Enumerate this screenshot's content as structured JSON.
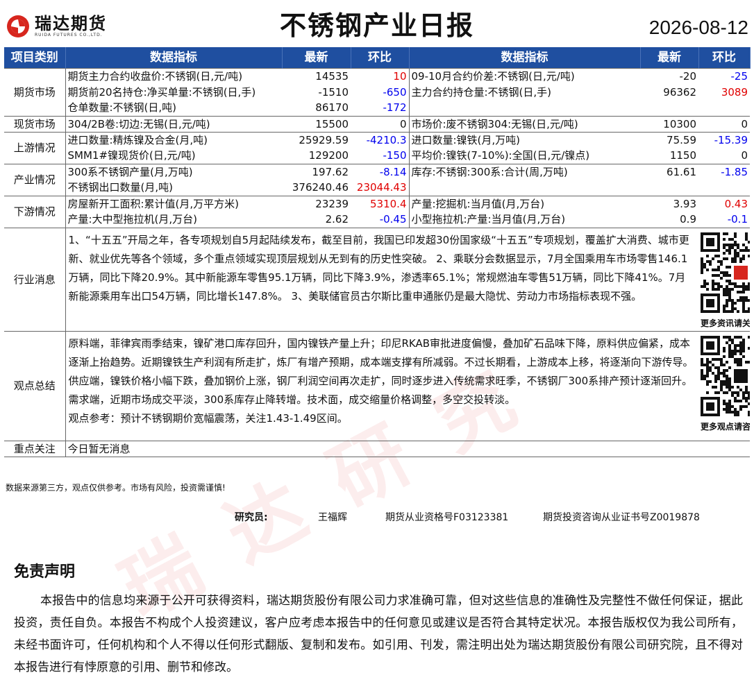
{
  "header": {
    "logo_cn": "瑞达期货",
    "logo_en": "RUIDA FUTURES CO.,LTD.",
    "title": "不锈钢产业日报",
    "date": "2026-08-12"
  },
  "columns": {
    "category": "项目类别",
    "indicator": "数据指标",
    "latest": "最新",
    "change": "环比",
    "indicator2": "数据指标",
    "latest2": "最新",
    "change2": "环比"
  },
  "sections": {
    "futures": "期货市场",
    "spot": "现货市场",
    "upstream": "上游情况",
    "industry": "产业情况",
    "downstream": "下游情况",
    "news": "行业消息",
    "view": "观点总结",
    "focus": "重点关注"
  },
  "rows": [
    {
      "l": "期货主力合约收盘价:不锈钢(日,元/吨)",
      "lv": "14535",
      "lc": "10",
      "lcc": "red",
      "r": "09-10月合约价差:不锈钢(日,元/吨)",
      "rv": "-20",
      "rc": "-25",
      "rcc": "blue"
    },
    {
      "l": "期货前20名持仓:净买单量:不锈钢(日,手)",
      "lv": "-1510",
      "lc": "-650",
      "lcc": "blue",
      "r": "主力合约持仓量:不锈钢(日,手)",
      "rv": "96362",
      "rc": "3089",
      "rcc": "red"
    },
    {
      "l": "仓单数量:不锈钢(日,吨)",
      "lv": "86170",
      "lc": "-172",
      "lcc": "blue",
      "r": "",
      "rv": "",
      "rc": "",
      "rcc": "blk"
    },
    {
      "l": "304/2B卷:切边:无锡(日,元/吨)",
      "lv": "15500",
      "lc": "0",
      "lcc": "blk",
      "r": "市场价:废不锈钢304:无锡(日,元/吨)",
      "rv": "10300",
      "rc": "0",
      "rcc": "blk"
    },
    {
      "l": "进口数量:精炼镍及合金(月,吨)",
      "lv": "25929.59",
      "lc": "-4210.3",
      "lcc": "blue",
      "r": "进口数量:镍铁(月,万吨)",
      "rv": "75.59",
      "rc": "-15.39",
      "rcc": "blue"
    },
    {
      "l": "SMM1#镍现货价(日,元/吨)",
      "lv": "129200",
      "lc": "-150",
      "lcc": "blue",
      "r": "平均价:镍铁(7-10%):全国(日,元/镍点)",
      "rv": "1150",
      "rc": "0",
      "rcc": "blk"
    },
    {
      "l": "300系不锈钢产量(月,万吨)",
      "lv": "197.62",
      "lc": "-8.14",
      "lcc": "blue",
      "r": "库存:不锈钢:300系:合计(周,万吨)",
      "rv": "61.61",
      "rc": "-1.85",
      "rcc": "blue"
    },
    {
      "l": "不锈钢出口数量(月,吨)",
      "lv": "376240.46",
      "lc": "23044.43",
      "lcc": "red",
      "r": "",
      "rv": "",
      "rc": "",
      "rcc": "blk"
    },
    {
      "l": "房屋新开工面积:累计值(月,万平方米)",
      "lv": "23239",
      "lc": "5310.4",
      "lcc": "red",
      "r": "产量:挖掘机:当月值(月,万台)",
      "rv": "3.93",
      "rc": "0.43",
      "rcc": "red"
    },
    {
      "l": "产量:大中型拖拉机(月,万台)",
      "lv": "2.62",
      "lc": "-0.45",
      "lcc": "blue",
      "r": "小型拖拉机:产量:当月值(月,万台)",
      "rv": "0.9",
      "rc": "-0.1",
      "rcc": "blue"
    }
  ],
  "news_text": "1、“十五五”开局之年，各专项规划自5月起陆续发布，截至目前，我国已印发超30份国家级“十五五”专项规划，覆盖扩大消费、城市更新、就业优先等各个领域，多个重点领域实现顶层规划从无到有的历史性突破。 2、乘联分会数据显示，7月全国乘用车市场零售146.1万辆，同比下降20.9%。其中新能源车零售95.1万辆，同比下降3.9%，渗透率65.1%；常规燃油车零售51万辆，同比下降41%。7月新能源乘用车出口54万辆，同比增长147.8%。 3、美联储官员古尔斯比重申通胀仍是最大隐忧、劳动力市场指标表现不强。",
  "news_qr_caption": "更多资讯请关注!",
  "view_text": "原料端，菲律宾雨季结束，镍矿港口库存回升，国内镍铁产量上升；印尼RKAB审批进度偏慢，叠加矿石品味下降，原料供应偏紧，成本逐渐上抬趋势。近期镍铁生产利润有所走扩，炼厂有增产预期，成本端支撑有所减弱。不过长期看，上游成本上移，将逐渐向下游传导。供应端，镍铁价格小幅下跌，叠加钢价上涨，钢厂利润空间再次走扩，同时逐步进入传统需求旺季，不锈钢厂300系排产预计逐渐回升。需求端，近期市场成交平淡，300系库存止降转增。技术面，成交缩量价格调整，多空交投转淡。",
  "view_ref": "观点参考：预计不锈钢期价宽幅震荡，关注1.43-1.49区间。",
  "view_qr_caption": "更多观点请咨询!",
  "focus_text": "今日暂无消息",
  "foot_note": "数据来源第三方，观点仅供参考。市场有风险，投资需谨慎!",
  "researcher": {
    "label": "研究员:",
    "name": "王福辉",
    "license1": "期货从业资格号F03123381",
    "license2": "期货投资咨询从业证书号Z0019878"
  },
  "disclaimer": {
    "title": "免责声明",
    "body": "本报告中的信息均来源于公开可获得资料，瑞达期货股份有限公司力求准确可靠，但对这些信息的准确性及完整性不做任何保证，据此投资，责任自负。本报告不构成个人投资建议，客户应考虑本报告中的任何意见或建议是否符合其特定状况。本报告版权仅为我公司所有，未经书面许可，任何机构和个人不得以任何形式翻版、复制和发布。如引用、刊发，需注明出处为瑞达期货股份有限公司研究院，且不得对本报告进行有悖原意的引用、删节和修改。"
  },
  "colors": {
    "header_bg": "#1f4fa0",
    "up": "#e00000",
    "down": "#0000ee"
  }
}
